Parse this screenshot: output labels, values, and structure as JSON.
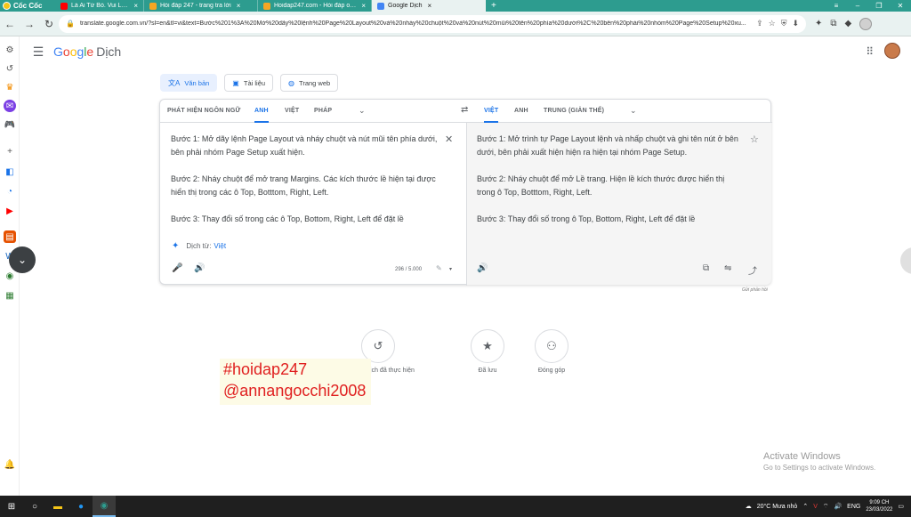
{
  "browser": {
    "brand": "Cốc Cốc",
    "tabs": [
      {
        "title": "Là Ai Từ Bỏ. Vui Lắm Nhé",
        "color": "#ff0000"
      },
      {
        "title": "Hỏi đáp 247 - trang tra lời",
        "color": "#f5a623"
      },
      {
        "title": "Hoidap247.com - Hỏi đáp online",
        "color": "#f5a623"
      },
      {
        "title": "Google Dịch",
        "color": "#4285f4"
      }
    ],
    "url": "translate.google.com.vn/?sl=en&tl=vi&text=Bước%201%3A%20Mở%20dãy%20lệnh%20Page%20Layout%20và%20nháy%20chuột%20và%20nút%20mũi%20tên%20phía%20dưới%2C%20bên%20phải%20nhóm%20Page%20Setup%20xu..."
  },
  "gt": {
    "logo": {
      "g": "G",
      "o1": "o",
      "o2": "o",
      "g2": "g",
      "l": "l",
      "e": "e",
      "suffix": "Dịch"
    },
    "modes": [
      "Văn bản",
      "Tài liệu",
      "Trang web"
    ],
    "source_langs": [
      "PHÁT HIỆN NGÔN NGỮ",
      "ANH",
      "VIỆT",
      "PHÁP"
    ],
    "target_langs": [
      "VIỆT",
      "ANH",
      "TRUNG (GIẢN THỂ)"
    ],
    "source_text": [
      "Bước 1: Mở dãy lệnh Page Layout và nháy chuột và nút mũi tên phía dưới, bên phải nhóm Page Setup xuất hiện.",
      "Bước 2: Nháy chuột để mở trang Margins. Các kích thước lề hiện tại được hiển thị trong các ô Top, Botttom, Right, Left.",
      "Bước 3: Thay đổi số trong các ô Top, Bottom, Right, Left để đặt lề"
    ],
    "detected": {
      "label": "Dịch từ:",
      "lang": "Việt"
    },
    "char_count": "296 / 5.000",
    "target_text": [
      "Bước 1: Mở trình tự Page Layout lệnh và nhấp chuột và ghi tên nút ở bên dưới, bên phải xuất hiện hiện ra hiện tại nhóm Page Setup.",
      "Bước 2: Nháy chuột để mở Lề trang. Hiện lề kích thước được hiển thị trong ô Top, Botttom, Right, Left.",
      "Bước 3: Thay đổi số trong ô Top, Bottom, Right, Left để đặt lề"
    ],
    "feedback": "Gửi phản hồi",
    "features": [
      {
        "label": "Các bản dịch đã thực hiện",
        "icon": "history-icon"
      },
      {
        "label": "Đã lưu",
        "icon": "star-icon"
      },
      {
        "label": "Đóng góp",
        "icon": "people-icon"
      }
    ]
  },
  "watermark": [
    "#hoidap247",
    "@annangocchi2008"
  ],
  "activate": {
    "title": "Activate Windows",
    "sub": "Go to Settings to activate Windows."
  },
  "taskbar": {
    "weather": "20°C  Mưa nhỏ",
    "lang": "ENG",
    "time": "9:09 CH",
    "date": "23/03/2022"
  }
}
